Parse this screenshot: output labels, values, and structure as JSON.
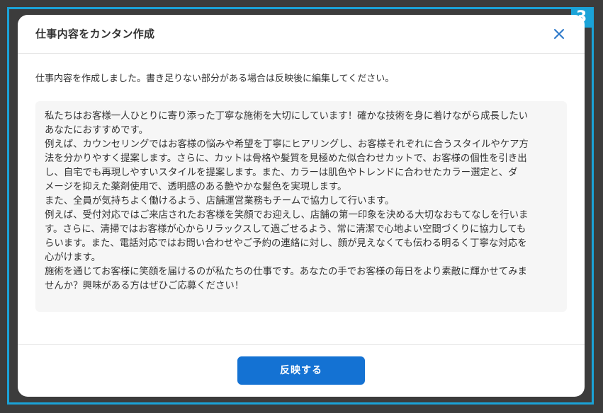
{
  "step_badge": "3",
  "modal": {
    "title": "仕事内容をカンタン作成",
    "close_icon": "close-icon",
    "description": "仕事内容を作成しました。書き足りない部分がある場合は反映後に編集してください。",
    "generated_lines": [
      "私たちはお客様一人ひとりに寄り添った丁寧な施術を大切にしています！確かな技術を身に着けながら成長したい",
      "あなたにおすすめです。",
      "例えば、カウンセリングではお客様の悩みや希望を丁寧にヒアリングし、お客様それぞれに合うスタイルやケア方",
      "法を分かりやすく提案します。さらに、カットは骨格や髪質を見極めた似合わせカットで、お客様の個性を引き出",
      "し、自宅でも再現しやすいスタイルを提案します。また、カラーは肌色やトレンドに合わせたカラー選定と、ダ",
      "メージを抑えた薬剤使用で、透明感のある艶やかな髪色を実現します。",
      "また、全員が気持ちよく働けるよう、店舗運営業務もチームで協力して行います。",
      "例えば、受付対応ではご来店されたお客様を笑顔でお迎えし、店舗の第一印象を決める大切なおもてなしを行いま",
      "す。さらに、清掃ではお客様が心からリラックスして過ごせるよう、常に清潔で心地よい空間づくりに協力しても",
      "らいます。また、電話対応ではお問い合わせやご予約の連絡に対し、顔が見えなくても伝わる明るく丁寧な対応を",
      "心がけます。",
      "施術を通じてお客様に笑顔を届けるのが私たちの仕事です。あなたの手でお客様の毎日をより素敵に輝かせてみま",
      "せんか？興味がある方はぜひご応募ください！"
    ],
    "apply_button_label": "反映する"
  },
  "colors": {
    "frame": "#1aa3d8",
    "primary_button": "#1472d3",
    "overlay": "#3c3c3c"
  }
}
